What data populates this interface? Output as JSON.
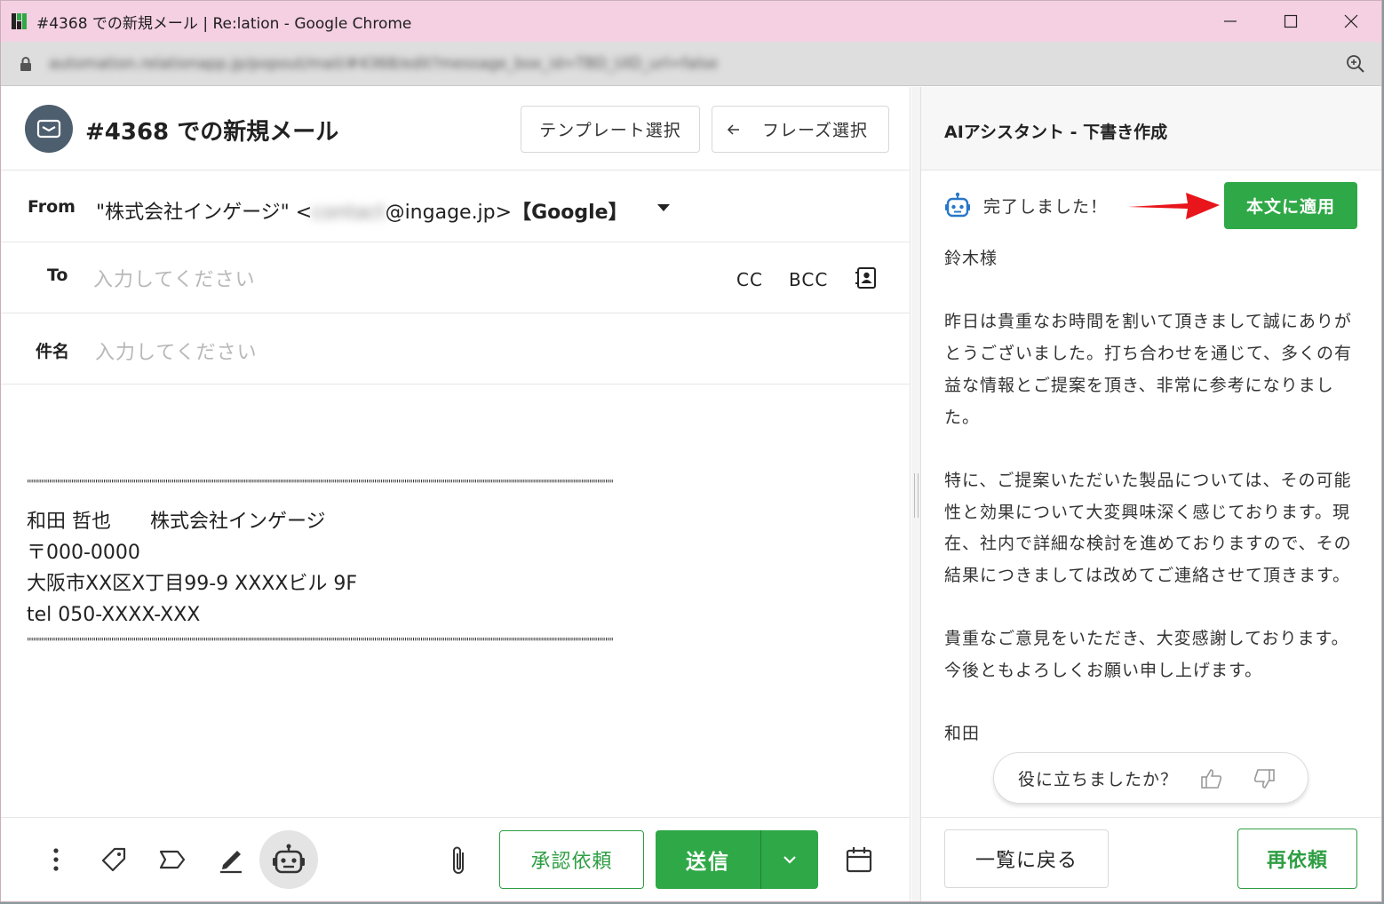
{
  "browser": {
    "title": "#4368 での新規メール | Re:lation - Google Chrome",
    "url": "automation.relationapp.jp/popout/mail/#4368/edit?message_box_id=TBD_UID_url=false"
  },
  "compose": {
    "title": "#4368 での新規メール",
    "template_button": "テンプレート選択",
    "phrase_button": "フレーズ選択",
    "from_label": "From",
    "from_name": "\"株式会社インゲージ\" <",
    "from_user": "contact",
    "from_domain": "@ingage.jp>",
    "from_provider": "【Google】",
    "to_label": "To",
    "to_placeholder": "入力してください",
    "cc_label": "CC",
    "bcc_label": "BCC",
    "subject_label": "件名",
    "subject_placeholder": "入力してください",
    "signature": {
      "separator": "\"\"\"\"\"\"\"\"\"\"\"\"\"\"\"\"\"\"\"\"\"\"\"\"\"\"\"\"\"\"\"\"\"\"\"\"\"\"\"\"\"\"\"\"\"\"\"\"\"\"\"\"\"\"\"\"\"\"\"\"\"\"\"\"\"\"\"\"\"\"\"\"\"\"\"\"\"\"\"\"\"\"\"\"\"\"\"\"\"\"\"\"\"\"\"\"\"\"\"\"\"\"\"\"\"\"\"\"\"\"\"\"\"\"\"\"\"\"\"\"\"\"\"\"\"\"\"\"\"\"\"\"\"\"\"\"\"\"\"\"\"\"\"\"\"\"",
      "line1": "和田 哲也　　株式会社インゲージ",
      "line2": "〒000-0000",
      "line3": "大阪市XX区X丁目99-9 XXXXビル 9F",
      "line4": "tel 050-XXXX-XXX"
    },
    "approve_button": "承認依頼",
    "send_button": "送信"
  },
  "ai": {
    "title": "AIアシスタント - 下書き作成",
    "status": "完了しました！",
    "apply_button": "本文に適用",
    "draft": {
      "p1": "鈴木様",
      "p2": "昨日は貴重なお時間を割いて頂きまして誠にありがとうございました。打ち合わせを通じて、多くの有益な情報とご提案を頂き、非常に参考になりました。",
      "p3": "特に、ご提案いただいた製品については、その可能性と効果について大変興味深く感じております。現在、社内で詳細な検討を進めておりますので、その結果につきましては改めてご連絡させて頂きます。",
      "p4": "貴重なご意見をいただき、大変感謝しております。今後ともよろしくお願い申し上げます。",
      "p5": "和田"
    },
    "feedback_question": "役に立ちましたか？",
    "back_button": "一覧に戻る",
    "retry_button": "再依頼"
  },
  "colors": {
    "accent_green": "#2fa847",
    "title_bar": "#f5d0e2",
    "arrow_red": "#e8151b"
  }
}
